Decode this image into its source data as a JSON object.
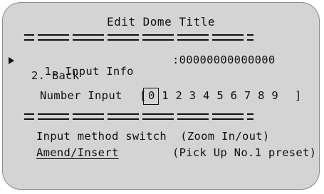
{
  "osd": {
    "title": "Edit Dome Title",
    "menu": [
      {
        "label": "1. Input Info",
        "value": ":00000000000000"
      },
      {
        "label": "2. Back"
      }
    ],
    "number_input": {
      "label": "Number Input",
      "digits": "0 1 2 3 4 5 6 7 8 9",
      "bracket_open": "[",
      "bracket_close": "]",
      "selected_digit": "0"
    },
    "help": {
      "line1": "Input method switch  (Zoom In/out)",
      "amend_label": "Amend/Insert",
      "amend_hint": "(Pick Up No.1 preset)"
    }
  }
}
